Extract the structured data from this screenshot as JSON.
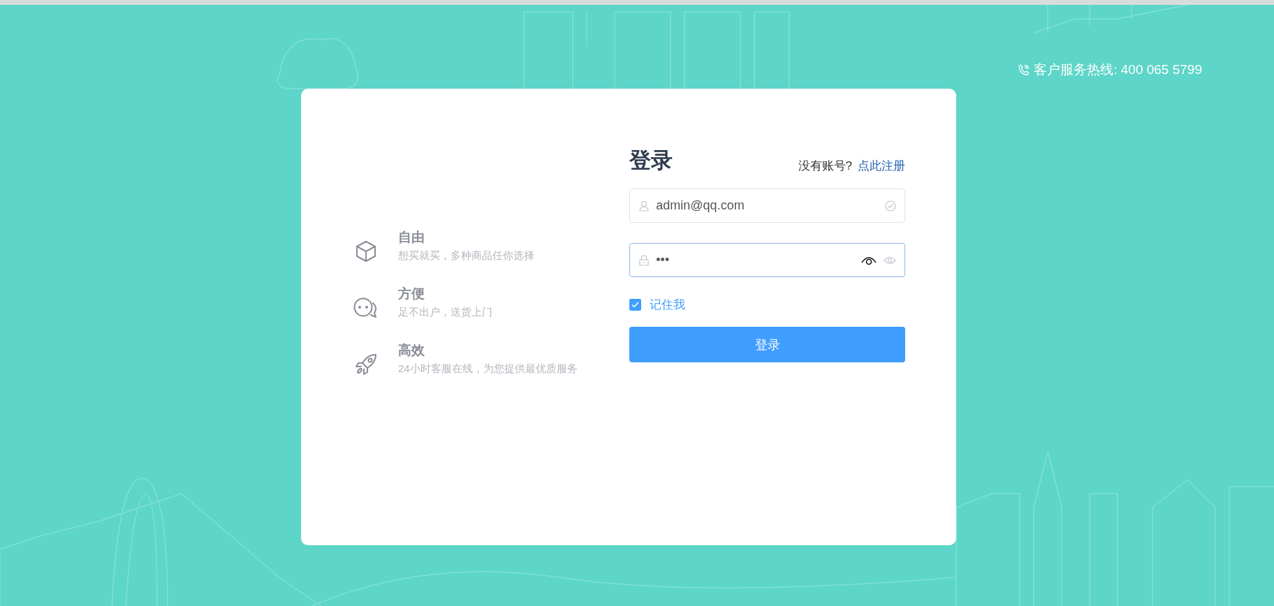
{
  "hotline": {
    "text": "客户服务热线: 400 065 5799"
  },
  "features": [
    {
      "kind": "cube",
      "title": "自由",
      "desc": "想买就买，多种商品任你选择"
    },
    {
      "kind": "chat",
      "title": "方便",
      "desc": "足不出户，送货上门"
    },
    {
      "kind": "rocket",
      "title": "高效",
      "desc": "24小时客服在线，为您提供最优质服务"
    }
  ],
  "login": {
    "title": "登录",
    "prompt": "没有账号?",
    "register_link": "点此注册",
    "username": {
      "value": "admin@qq.com",
      "valid": true
    },
    "password": {
      "value": "•••",
      "focused": true
    },
    "remember": {
      "label": "记住我",
      "checked": true
    },
    "submit": "登录"
  }
}
